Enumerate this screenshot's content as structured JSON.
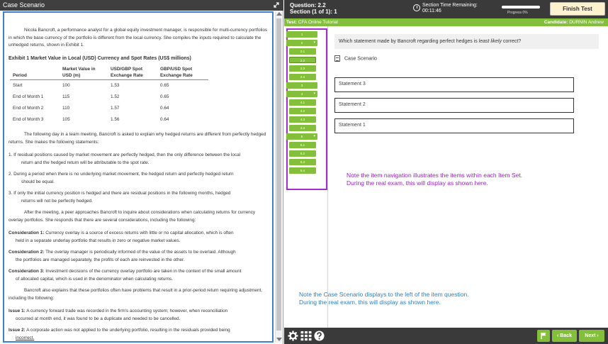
{
  "left_pane": {
    "title": "Case Scenario",
    "intro": "Nicola Bancroft, a performance analyst for a global equity investment manager, is responsible for multi-currency portfolios in which the base currency of the portfolio is different from the local currency. She compiles the inputs required to calculate the unhedged returns, shown in Exhibit 1.",
    "exhibit": {
      "title": "Exhibit 1 Market Value in Local (USD) Currency and Spot Rates (US$ millions)",
      "headers": [
        "Period",
        "Market Value in USD (m)",
        "USD/GBP Spot Exchange Rate",
        "GBP/USD Spot Exchange Rate"
      ],
      "rows": [
        [
          "Start",
          "100",
          "1.53",
          "0.65"
        ],
        [
          "End of Month 1",
          "115",
          "1.52",
          "0.65"
        ],
        [
          "End of Month 2",
          "110",
          "1.57",
          "0.64"
        ],
        [
          "End of Month 3",
          "105",
          "1.56",
          "0.64"
        ]
      ]
    },
    "para2": "The following day in a team meeting, Bancroft is asked to explain why hedged returns are different from perfectly hedged returns. She makes the following statements:",
    "statements": [
      {
        "num": "1.",
        "first": "If residual positions caused by market movement are perfectly hedged, then the only difference between the local",
        "cont": "return and the hedged return will be attributable to the spot rate."
      },
      {
        "num": "2.",
        "first": "During a period when there is no underlying market movement, the hedged return and perfectly hedged return",
        "cont": "should be equal."
      },
      {
        "num": "3.",
        "first": "If only the initial currency position is hedged and there are residual positions in the following months, hedged",
        "cont": "returns will not be perfectly hedged."
      }
    ],
    "para3": "After the meeting, a peer approaches Bancroft to inquire about considerations when calculating returns for currency overlay portfolios. She responds that there are several considerations, including the following:",
    "considerations": [
      {
        "label": "Consideration 1:",
        "first": "Currency overlay is a source of excess returns with little or no capital allocation, which is often",
        "cont": "held in a separate underlay portfolio that results in zero or negative market values."
      },
      {
        "label": "Consideration 2:",
        "first": "The overlay manager is periodically informed of the value of the assets to be overlaid. Although",
        "cont": "the portfolios are managed separately, the profits of each are reinvested in the other."
      },
      {
        "label": "Consideration 3:",
        "first": "Investment decisions of the currency overlay portfolio are taken in the context of the small amount",
        "cont": "of allocated capital, which is used in the denominator when calculating returns."
      }
    ],
    "para4": "Bancroft also explains that these portfolios often have problems that result in a prior-period return requiring adjustment, including the following:",
    "issues": [
      {
        "label": "Issue 1:",
        "first": "A currency forward trade was recorded in the firm's accounting system; however, when reconciliation",
        "cont": "occurred at month end, it was found to be a duplicate and needed to be cancelled."
      },
      {
        "label": "Issue 2:",
        "first": "A corporate action was not applied to the underlying portfolio, resulting in the residuals provided being",
        "cont": "incorrect."
      }
    ]
  },
  "header": {
    "question_line": "Question: 2.2",
    "section_line": "Section (1 of 1): 1",
    "time_label": "Section Time Remaining:",
    "time_value": "00:11:46",
    "progress_label": "Progress 0%",
    "progress_value": 0,
    "finish_label": "Finish Test"
  },
  "greenbar": {
    "test_prefix": "Test:",
    "test_name": " CFA Online Tutorial",
    "cand_prefix": "Candidate:",
    "cand_name": " DURNIN Andrew"
  },
  "nav": {
    "items": [
      "1",
      "2",
      "2.1",
      "2.2",
      "2.3",
      "2.4",
      "3",
      "4",
      "4.1",
      "4.2",
      "4.3",
      "4.4",
      "5",
      "5.1",
      "5.2",
      "5.3",
      "5.4"
    ]
  },
  "main": {
    "question_text_pre": "Which statement made by Bancroft regarding perfect hedges is ",
    "question_em": "least likely",
    "question_text_post": " correct?",
    "case_link": "Case Scenario",
    "options": [
      "Statement 3",
      "Statement 2",
      "Statement 1"
    ],
    "note_purple_1": "Note the item navigation illustrates the items within each Item Set.",
    "note_purple_2": "During the real exam, this will display as shown here.",
    "note_blue_1": "Note the Case Scenario displays to the left of the item question.",
    "note_blue_2": "During the real exam, this will display as shown here."
  },
  "footer": {
    "back_label": "Back",
    "next_label": "Next"
  },
  "colors": {
    "green": "#84bf3b",
    "purple": "#a52ccf",
    "blue": "#3f7fd0",
    "dark": "#3a3a3a"
  }
}
